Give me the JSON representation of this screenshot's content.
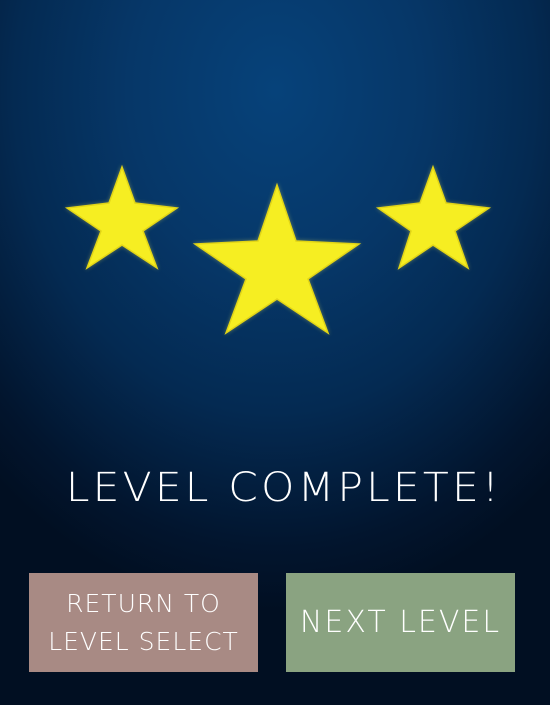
{
  "game": {
    "rating": {
      "earned": 3,
      "max": 3
    },
    "star_color": "#f6ee22",
    "title": "LEVEL COMPLETE!",
    "buttons": {
      "return_line1": "RETURN TO",
      "return_line2": "LEVEL SELECT",
      "return_color": "#a88a84",
      "next_label": "NEXT LEVEL",
      "next_color": "#8aa381"
    }
  }
}
